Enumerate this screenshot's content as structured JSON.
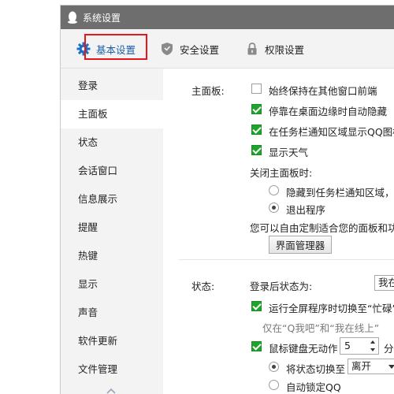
{
  "window": {
    "title": "系统设置"
  },
  "tabs": [
    {
      "label": "基本设置",
      "icon": "gear-icon",
      "active": true
    },
    {
      "label": "安全设置",
      "icon": "shield-icon",
      "active": false
    },
    {
      "label": "权限设置",
      "icon": "lock-icon",
      "active": false
    }
  ],
  "sidebar": {
    "items": [
      {
        "label": "登录"
      },
      {
        "label": "主面板",
        "active": true
      },
      {
        "label": "状态"
      },
      {
        "label": "会话窗口"
      },
      {
        "label": "信息展示"
      },
      {
        "label": "提醒"
      },
      {
        "label": "热键"
      },
      {
        "label": "显示"
      },
      {
        "label": "声音"
      },
      {
        "label": "软件更新"
      },
      {
        "label": "文件管理"
      }
    ]
  },
  "main_panel": {
    "section_label": "主面板:",
    "always_on_top": "始终保持在其他窗口前端",
    "auto_hide": "停靠在桌面边缘时自动隐藏",
    "show_tray_icon": "在任务栏通知区域显示QQ图标",
    "show_weather": "显示天气",
    "close_label": "关闭主面板时:",
    "close_hide": "隐藏到任务栏通知区域，不",
    "close_exit": "退出程序",
    "customize_text": "您可以自由定制适合您的面板和功能",
    "manager_button": "界面管理器"
  },
  "status": {
    "section_label": "状态:",
    "after_login_label": "登录后状态为:",
    "after_login_value": "我在线上",
    "fullscreen_busy": "运行全屏程序时切换至“忙碌”",
    "fullscreen_note": "仅在“Q我吧”和“我在线上”",
    "idle_label": "鼠标键盘无动作",
    "idle_minutes": "5",
    "idle_unit": "分钟",
    "switch_status_label": "将状态切换至",
    "switch_status_value": "离开",
    "auto_lock": "自动锁定QQ"
  },
  "colors": {
    "titlebar": "#6e6e6e",
    "check_green": "#1fa32c",
    "active_tab_text": "#1c5fa8",
    "highlight_box": "#e8151b"
  }
}
